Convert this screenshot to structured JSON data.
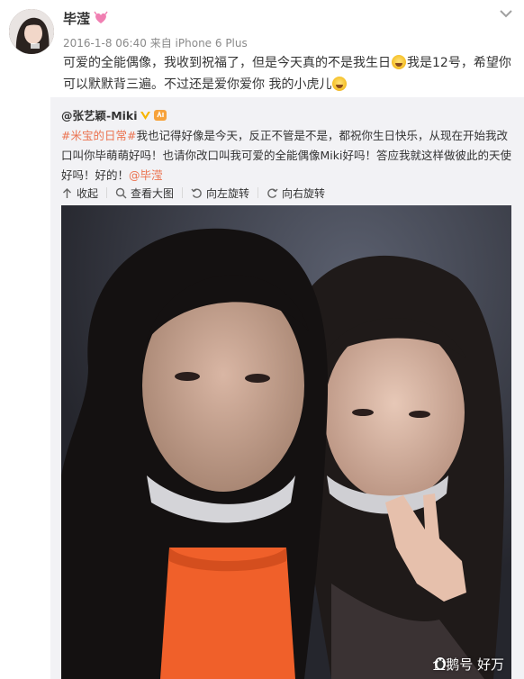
{
  "post": {
    "username": "毕滢",
    "timestamp": "2016-1-8 06:40",
    "source_prefix": "来自",
    "source": "iPhone 6 Plus",
    "text_part1": "可爱的全能偶像，我收到祝福了，但是今天真的不是我生日",
    "text_part2": "我是12号，希望你可以默默背三遍。不过还是爱你爱你 我的小虎儿",
    "avatar_icon": "avatar-photo",
    "vip_icon": "heart-badge-icon",
    "menu_icon": "chevron-down-icon"
  },
  "repost": {
    "author": "@张艺颖-Miki",
    "topic": "#米宝的日常#",
    "text": "我也记得好像是今天，反正不管是不是，都祝你生日快乐，从现在开始我改口叫你毕萌萌好吗！也请你改口叫我可爱的全能偶像Miki好吗！答应我就这样做彼此的天使好吗！好的！",
    "mention": "@毕滢",
    "toolbar": {
      "collapse": "收起",
      "view_large": "查看大图",
      "rotate_left": "向左旋转",
      "rotate_right": "向右旋转"
    },
    "photo_watermark": "企鹅号 好万"
  },
  "colors": {
    "link": "#eb7350",
    "repost_bg": "#f2f2f5",
    "meta_gray": "#8a8a8a",
    "verified_gold": "#f7b500"
  }
}
